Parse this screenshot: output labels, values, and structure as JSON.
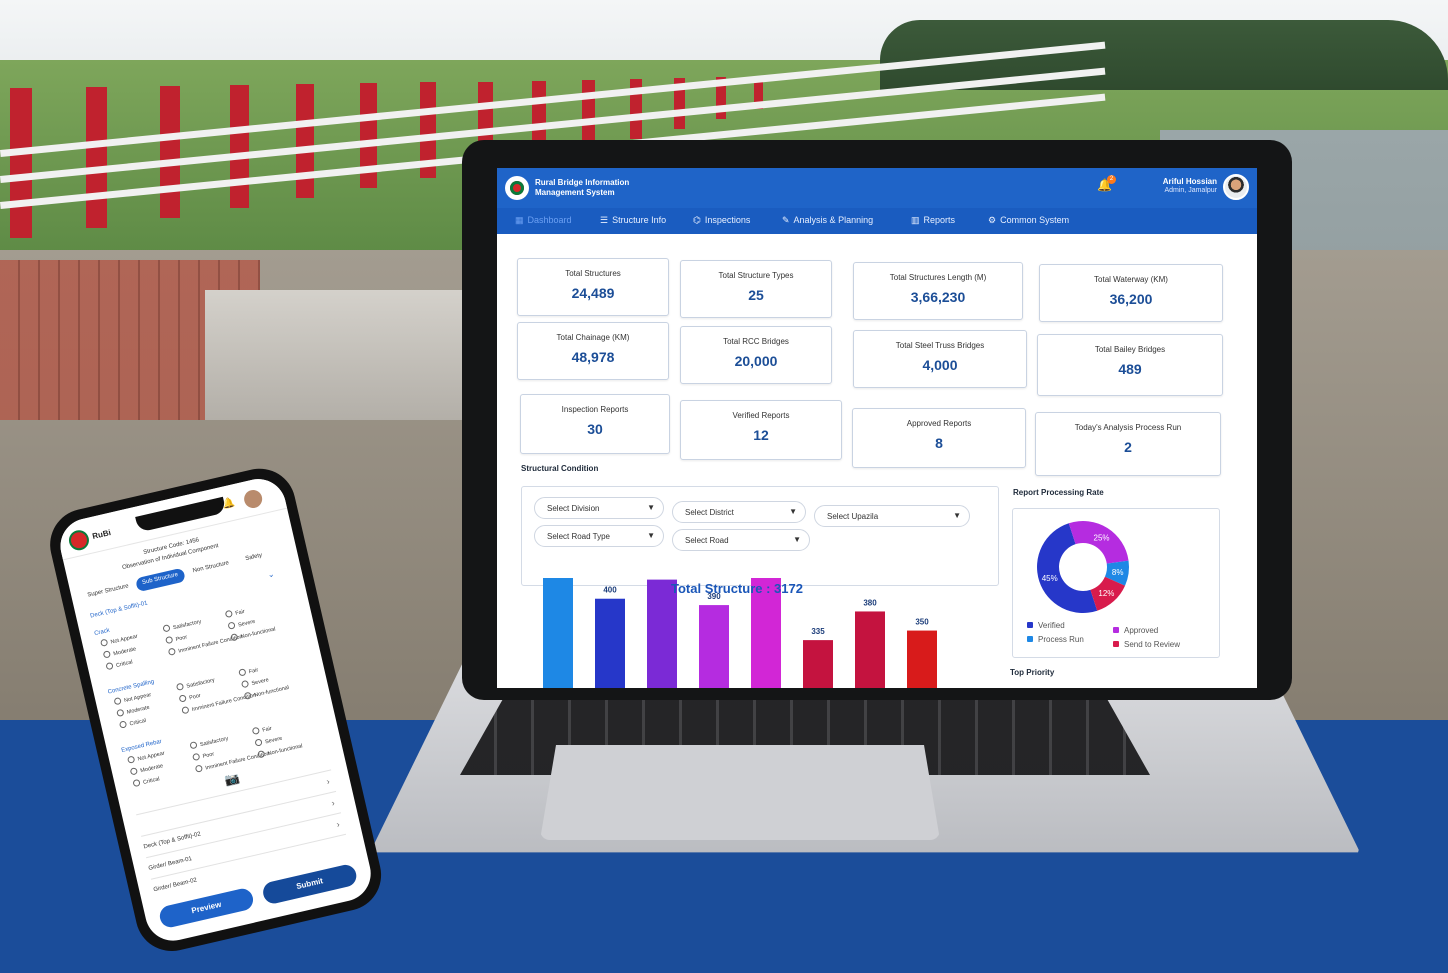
{
  "app": {
    "title": "Rural Bridge Information Management System",
    "notifications_count": "2",
    "user_name": "Ariful Hossian",
    "user_role": "Admin, Jamalpur"
  },
  "nav": [
    {
      "label": "Dashboard",
      "icon": "dashboard-icon",
      "glyph": "▦"
    },
    {
      "label": "Structure Info",
      "icon": "list-icon",
      "glyph": "☰"
    },
    {
      "label": "Inspections",
      "icon": "hierarchy-icon",
      "glyph": "⌬"
    },
    {
      "label": "Analysis & Planning",
      "icon": "analysis-icon",
      "glyph": "✎"
    },
    {
      "label": "Reports",
      "icon": "bar-chart-icon",
      "glyph": "▥"
    },
    {
      "label": "Common System",
      "icon": "gear-icon",
      "glyph": "⚙"
    }
  ],
  "stats": [
    {
      "label": "Total Structures",
      "value": "24,489"
    },
    {
      "label": "Total Structure Types",
      "value": "25"
    },
    {
      "label": "Total Structures Length (M)",
      "value": "3,66,230"
    },
    {
      "label": "Total Waterway (KM)",
      "value": "36,200"
    },
    {
      "label": "Total Chainage (KM)",
      "value": "48,978"
    },
    {
      "label": "Total RCC Bridges",
      "value": "20,000"
    },
    {
      "label": "Total Steel Truss Bridges",
      "value": "4,000"
    },
    {
      "label": "Total Bailey Bridges",
      "value": "489"
    },
    {
      "label": "Inspection Reports",
      "value": "30"
    },
    {
      "label": "Verified Reports",
      "value": "12"
    },
    {
      "label": "Approved Reports",
      "value": "8"
    },
    {
      "label": "Today's Analysis Process Run",
      "value": "2"
    }
  ],
  "structural_condition": {
    "title": "Structural Condition",
    "filters": [
      "Select Division",
      "Select District",
      "Select Upazila",
      "Select Road Type",
      "Select Road"
    ]
  },
  "report_rate": {
    "title": "Report Processing Rate",
    "top_priority": "Top Priority"
  },
  "chart_data": [
    {
      "type": "bar",
      "title": "Total Structure : 3172",
      "values": [
        452,
        400,
        430,
        390,
        435,
        335,
        380,
        350
      ],
      "colors": [
        "#1e88e5",
        "#2637c9",
        "#7b2ad6",
        "#b52ce0",
        "#d226d6",
        "#c4133f",
        "#c4133f",
        "#d81b1b"
      ],
      "ylim": [
        0,
        460
      ]
    },
    {
      "type": "pie",
      "title": "Report Processing Rate",
      "labels": [
        "Verified",
        "Approved",
        "Process Run",
        "Send to Review"
      ],
      "values": [
        45,
        25,
        8,
        12
      ],
      "value_labels": [
        "45%",
        "25%",
        "8%",
        "12%"
      ],
      "colors": [
        "#2637c9",
        "#b52ce0",
        "#1e88e5",
        "#d81b4c"
      ]
    }
  ],
  "phone": {
    "brand": "RuBi",
    "structure_code": "Structure Code: 1456",
    "subtitle": "Observation of Individual Component",
    "tabs": [
      "Super Structure",
      "Sub Structure",
      "Non Structure",
      "Safety"
    ],
    "section": "Deck (Top & Soffit)-01",
    "groups": [
      {
        "name": "Crack",
        "options": [
          "Not Appear",
          "Moderate",
          "Critical",
          "Satisfactory",
          "Poor",
          "Imminent Failure Condition",
          "Fair",
          "Severe",
          "Non-functional"
        ]
      },
      {
        "name": "Concrete Spalling",
        "options": [
          "Not Appear",
          "Moderate",
          "Critical",
          "Satisfactory",
          "Poor",
          "Imminent Failure Condition",
          "Fair",
          "Severe",
          "Non-functional"
        ]
      },
      {
        "name": "Exposed Rebar",
        "options": [
          "Not Appear",
          "Moderate",
          "Critical",
          "Satisfactory",
          "Poor",
          "Imminent Failure Condition",
          "Fair",
          "Severe",
          "Non-functional"
        ]
      }
    ],
    "rows": [
      "Deck (Top & Soffit)-02",
      "Girder/ Beam-01",
      "Girder/ Beam-02"
    ],
    "preview": "Preview",
    "submit": "Submit"
  }
}
